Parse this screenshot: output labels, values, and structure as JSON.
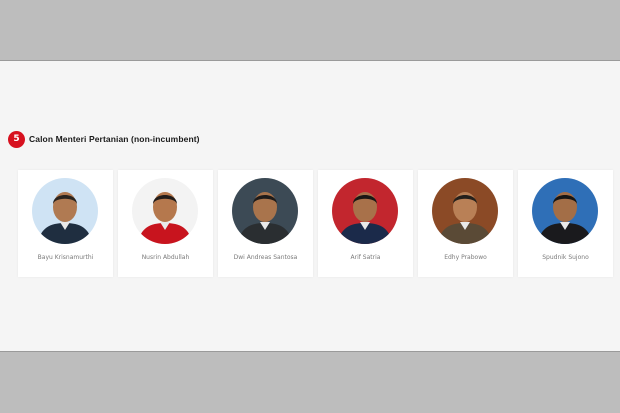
{
  "section": {
    "number": "5",
    "title": "Calon Menteri Pertanian (non-incumbent)"
  },
  "candidates": [
    {
      "name": "Bayu Krisnamurthi",
      "bg": "#cfe3f4",
      "suit": "#1f2e40",
      "skin": "#b07a52",
      "hair": "#2a2420"
    },
    {
      "name": "Nusrin Abdullah",
      "bg": "#f3f3f3",
      "suit": "#c8141e",
      "skin": "#b5784d",
      "hair": "#221c1a"
    },
    {
      "name": "Dwi Andreas Santosa",
      "bg": "#3c4a55",
      "suit": "#2a2e31",
      "skin": "#a9744c",
      "hair": "#1e1b1a"
    },
    {
      "name": "Arif Satria",
      "bg": "#c2262e",
      "suit": "#1b2a4a",
      "skin": "#a8714a",
      "hair": "#191715"
    },
    {
      "name": "Edhy Prabowo",
      "bg": "#8b4a26",
      "suit": "#5a4a36",
      "skin": "#b98056",
      "hair": "#24201c"
    },
    {
      "name": "Spudnik Sujono",
      "bg": "#2f6fb7",
      "suit": "#1a1a1d",
      "skin": "#a36e47",
      "hair": "#151515"
    }
  ]
}
